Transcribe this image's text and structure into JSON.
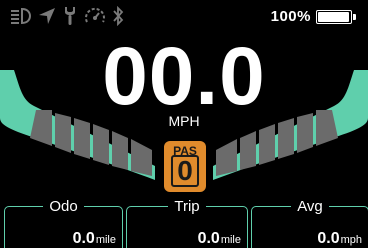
{
  "status_icons": [
    "headlight-icon",
    "navigation-icon",
    "wrench-icon",
    "speedometer-icon",
    "bluetooth-icon"
  ],
  "battery": {
    "percent_text": "100%",
    "level": 1.0
  },
  "speed": {
    "value": "00.0",
    "unit": "MPH"
  },
  "pas": {
    "label": "PAS",
    "level": "0"
  },
  "panels": [
    {
      "title": "Odo",
      "value": "0.0",
      "unit": "mile"
    },
    {
      "title": "Trip",
      "value": "0.0",
      "unit": "mile"
    },
    {
      "title": "Avg",
      "value": "0.0",
      "unit": "mph"
    }
  ],
  "colors": {
    "accent": "#5fcfac",
    "pas": "#e08b2c",
    "segment": "#6b6b6b",
    "icon_dim": "#7a7a7a",
    "background": "#000000"
  }
}
